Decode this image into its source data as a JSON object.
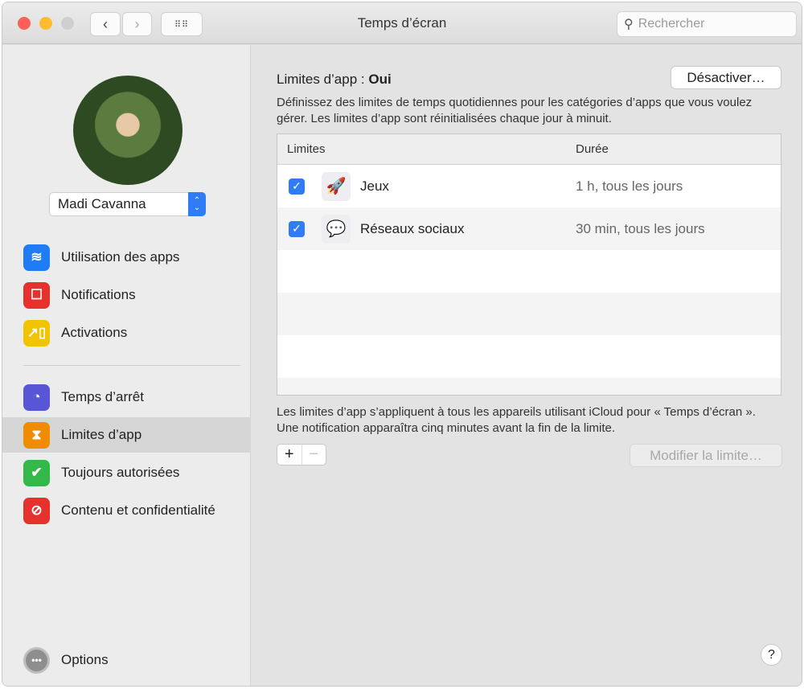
{
  "window": {
    "title": "Temps d’écran",
    "search_placeholder": "Rechercher",
    "traffic_lights": {
      "close": "#fe5f57",
      "minimize": "#febc2e",
      "zoom": "#cfcfcf"
    }
  },
  "sidebar": {
    "user_name": "Madi Cavanna",
    "group1": [
      {
        "label": "Utilisation des apps",
        "icon": "layers-icon",
        "color": "#1f7cf5"
      },
      {
        "label": "Notifications",
        "icon": "notification-icon",
        "color": "#e5322d"
      },
      {
        "label": "Activations",
        "icon": "pickup-icon",
        "color": "#f2c300"
      }
    ],
    "group2": [
      {
        "label": "Temps d’arrêt",
        "icon": "downtime-icon",
        "color": "#5856d6"
      },
      {
        "label": "Limites d’app",
        "icon": "hourglass-icon",
        "color": "#f08c00",
        "active": true
      },
      {
        "label": "Toujours autorisées",
        "icon": "checkmark-badge-icon",
        "color": "#34b84a"
      },
      {
        "label": "Contenu et confidentialité",
        "icon": "restriction-icon",
        "color": "#e5322d"
      }
    ],
    "options_label": "Options"
  },
  "main": {
    "header_label": "Limites d’app :",
    "header_value": "Oui",
    "deactivate_button": "Désactiver…",
    "description": "Définissez des limites de temps quotidiennes pour les catégories d’apps que vous voulez gérer. Les limites d’app sont réinitialisées chaque jour à minuit.",
    "table": {
      "columns": [
        "Limites",
        "Durée"
      ],
      "rows": [
        {
          "checked": true,
          "icon": "rocket-icon",
          "name": "Jeux",
          "duration": "1 h, tous les jours"
        },
        {
          "checked": true,
          "icon": "social-bubble-icon",
          "name": "Réseaux sociaux",
          "duration": "30 min, tous les jours"
        }
      ]
    },
    "footnote": "Les limites d’app s’appliquent à tous les appareils utilisant iCloud pour « Temps d’écran ». Une notification apparaîtra cinq minutes avant la fin de la limite.",
    "add_symbol": "+",
    "remove_symbol": "−",
    "edit_button": "Modifier la limite…",
    "help_symbol": "?"
  }
}
